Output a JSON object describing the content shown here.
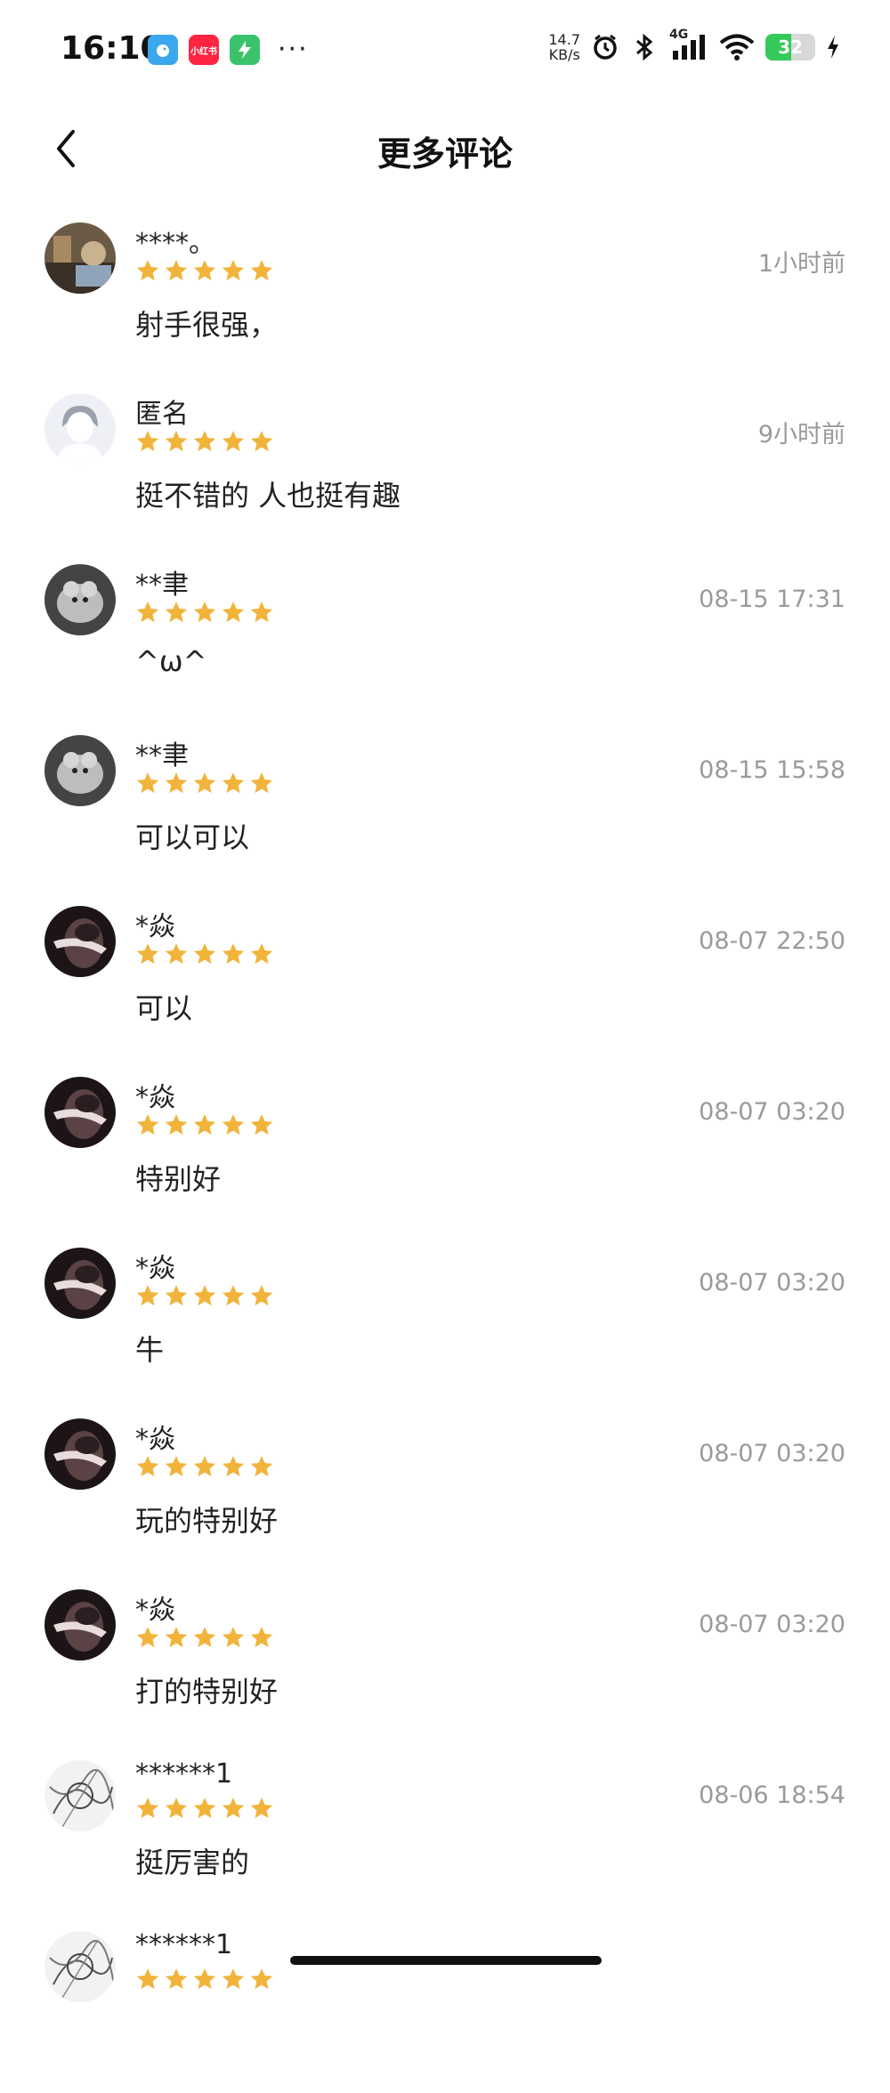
{
  "status_bar": {
    "time": "16:10",
    "net_speed_value": "14.7",
    "net_speed_unit": "KB/s",
    "network_type": "4G",
    "battery": "32",
    "app_icons": [
      {
        "name": "bird-app-icon",
        "color": "#3aa7ee"
      },
      {
        "name": "xiaohongshu-icon",
        "label": "小红书",
        "color": "#ff2442"
      },
      {
        "name": "bolt-app-icon",
        "color": "#3ac36b"
      }
    ],
    "more": "···"
  },
  "header": {
    "title": "更多评论",
    "back_icon": "chevron-left-icon"
  },
  "colors": {
    "star": "#f1b33a",
    "meta_text": "#9a9a9a",
    "battery_fill": "#35c959"
  },
  "reviews": [
    {
      "user": "****。",
      "rating": 5,
      "time": "1小时前",
      "comment": "射手很强，",
      "avatar": "photo-avatar"
    },
    {
      "user": "匿名",
      "rating": 5,
      "time": "9小时前",
      "comment": "挺不错的  人也挺有趣",
      "avatar": "default-avatar"
    },
    {
      "user": "**聿",
      "rating": 5,
      "time": "08-15 17:31",
      "comment": "^ω^",
      "avatar": "animal-avatar"
    },
    {
      "user": "**聿",
      "rating": 5,
      "time": "08-15 15:58",
      "comment": "可以可以",
      "avatar": "animal-avatar"
    },
    {
      "user": "*焱",
      "rating": 5,
      "time": "08-07 22:50",
      "comment": "可以",
      "avatar": "dark-portrait-avatar"
    },
    {
      "user": "*焱",
      "rating": 5,
      "time": "08-07 03:20",
      "comment": "特别好",
      "avatar": "dark-portrait-avatar"
    },
    {
      "user": "*焱",
      "rating": 5,
      "time": "08-07 03:20",
      "comment": "牛",
      "avatar": "dark-portrait-avatar"
    },
    {
      "user": "*焱",
      "rating": 5,
      "time": "08-07 03:20",
      "comment": "玩的特别好",
      "avatar": "dark-portrait-avatar"
    },
    {
      "user": "*焱",
      "rating": 5,
      "time": "08-07 03:20",
      "comment": "打的特别好",
      "avatar": "dark-portrait-avatar"
    },
    {
      "user": "******1",
      "rating": 5,
      "time": "08-06 18:54",
      "comment": "挺厉害的",
      "avatar": "sketch-avatar"
    },
    {
      "user": "******1",
      "rating": 5,
      "time": "",
      "comment": "",
      "avatar": "sketch-avatar"
    }
  ]
}
